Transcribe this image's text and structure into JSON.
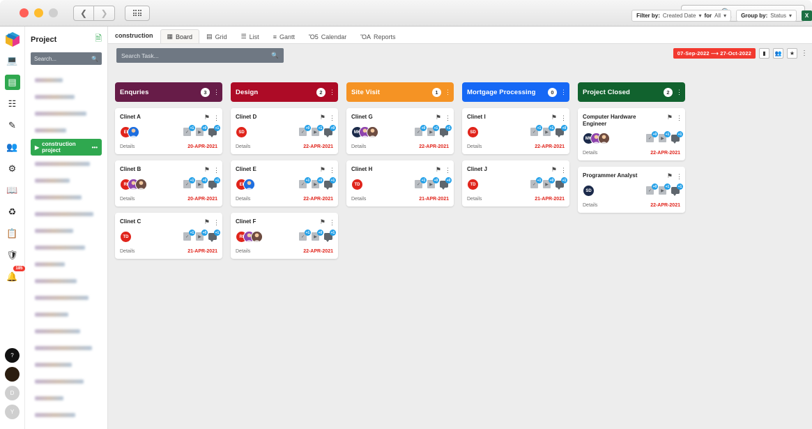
{
  "titlebar": {
    "search_label": "Search",
    "search_icon": "search-icon",
    "back_icon": "chevron-left-icon",
    "forward_icon": "chevron-right-icon",
    "grid_icon": "app-grid-icon"
  },
  "rail": {
    "logo_name": "app-logo",
    "items": [
      {
        "icon": "screen-icon",
        "active": false
      },
      {
        "icon": "dashboard-grid-icon",
        "active": true
      },
      {
        "icon": "modules-icon",
        "active": false
      },
      {
        "icon": "edit-square-icon",
        "active": false
      },
      {
        "icon": "team-icon",
        "active": false
      },
      {
        "icon": "settings-gear-icon",
        "active": false
      },
      {
        "icon": "book-icon",
        "active": false
      },
      {
        "icon": "recycle-add-icon",
        "active": false
      },
      {
        "icon": "clipboard-icon",
        "active": false
      },
      {
        "icon": "shield-icon",
        "active": false
      },
      {
        "icon": "bell-icon",
        "active": false,
        "badge": "185"
      }
    ],
    "bottom": [
      {
        "icon": "help-icon",
        "label": "?",
        "color": "#111111"
      },
      {
        "icon": "user-avatar-icon",
        "label": "",
        "color": "#2b1d10"
      },
      {
        "icon": "user-avatar-d",
        "label": "D",
        "color": "#cfcfcf"
      },
      {
        "icon": "user-avatar-y",
        "label": "Y",
        "color": "#cfcfcf"
      }
    ]
  },
  "sidebar": {
    "title": "Project",
    "export_icon": "file-export-icon",
    "search_placeholder": "Search...",
    "search_icon": "search-icon",
    "items": [
      {
        "label": "",
        "active": false
      },
      {
        "label": "",
        "active": false
      },
      {
        "label": "",
        "active": false
      },
      {
        "label": "",
        "active": false
      },
      {
        "label": "construction project",
        "active": true,
        "menu": "•••"
      },
      {
        "label": "",
        "active": false
      },
      {
        "label": "",
        "active": false
      },
      {
        "label": "",
        "active": false
      },
      {
        "label": "",
        "active": false
      },
      {
        "label": "",
        "active": false
      },
      {
        "label": "",
        "active": false
      },
      {
        "label": "",
        "active": false
      },
      {
        "label": "",
        "active": false
      },
      {
        "label": "",
        "active": false
      },
      {
        "label": "",
        "active": false
      },
      {
        "label": "",
        "active": false
      },
      {
        "label": "",
        "active": false
      },
      {
        "label": "",
        "active": false
      },
      {
        "label": "",
        "active": false
      },
      {
        "label": "",
        "active": false
      },
      {
        "label": "",
        "active": false
      }
    ]
  },
  "tabs": {
    "project_label": "construction",
    "items": [
      {
        "label": "Board",
        "icon": "board-icon",
        "active": true
      },
      {
        "label": "Grid",
        "icon": "grid-icon",
        "active": false
      },
      {
        "label": "List",
        "icon": "list-icon",
        "active": false
      },
      {
        "label": "Gantt",
        "icon": "gantt-icon",
        "active": false
      },
      {
        "label": "Calendar",
        "icon": "calendar-icon",
        "active": false
      },
      {
        "label": "Reports",
        "icon": "reports-icon",
        "active": false
      }
    ]
  },
  "toolbar": {
    "task_search_placeholder": "Search Task...",
    "task_search_icon": "search-icon",
    "filter_by_label": "Filter by:",
    "filter_by_value": "Created Date",
    "for_label": "for",
    "for_value": "All",
    "group_by_label": "Group by:",
    "group_by_value": "Status",
    "excel_icon": "excel-export-icon",
    "date_range": "07-Sep-2022 ⟶ 27-Oct-2022",
    "icon_buttons": [
      {
        "name": "flag-filter-icon"
      },
      {
        "name": "members-filter-icon"
      },
      {
        "name": "tag-filter-icon"
      }
    ],
    "more_menu_icon": "vertical-dots-icon"
  },
  "board": {
    "columns": [
      {
        "name": "Enquries",
        "count": "3",
        "color": "#671c48",
        "cards": [
          {
            "title": "Clinet A",
            "details_label": "Details",
            "date": "20-APR-2021",
            "avatars": [
              {
                "initials": "EI",
                "color": "#e0241b"
              },
              {
                "initials": "",
                "color": "#1e6fe0",
                "photo": true
              }
            ],
            "badges": [
              {
                "icon": "attachment-doc-icon",
                "count": "+1"
              },
              {
                "icon": "media-doc-icon",
                "count": "+0"
              },
              {
                "icon": "comment-icon",
                "count": "+1"
              }
            ]
          },
          {
            "title": "Clinet B",
            "details_label": "Details",
            "date": "20-APR-2021",
            "avatars": [
              {
                "initials": "RI",
                "color": "#e0241b"
              },
              {
                "initials": "",
                "color": "#8e44ad",
                "photo": true
              },
              {
                "initials": "",
                "color": "#6d4c41",
                "photo": true
              }
            ],
            "badges": [
              {
                "icon": "attachment-doc-icon",
                "count": "+1"
              },
              {
                "icon": "media-doc-icon",
                "count": "+0"
              },
              {
                "icon": "comment-icon",
                "count": "+1"
              }
            ]
          },
          {
            "title": "Clinet C",
            "details_label": "Details",
            "date": "21-APR-2021",
            "avatars": [
              {
                "initials": "TD",
                "color": "#e0241b"
              }
            ],
            "badges": [
              {
                "icon": "attachment-doc-icon",
                "count": "+1"
              },
              {
                "icon": "media-doc-icon",
                "count": "+0"
              },
              {
                "icon": "comment-icon",
                "count": "+1"
              }
            ]
          }
        ]
      },
      {
        "name": "Design",
        "count": "2",
        "color": "#ad0b26",
        "cards": [
          {
            "title": "Clinet D",
            "details_label": "Details",
            "date": "22-APR-2021",
            "avatars": [
              {
                "initials": "SD",
                "color": "#e0241b"
              }
            ],
            "badges": [
              {
                "icon": "attachment-doc-icon",
                "count": "+0"
              },
              {
                "icon": "media-doc-icon",
                "count": "+1"
              },
              {
                "icon": "comment-icon",
                "count": "+0"
              }
            ]
          },
          {
            "title": "Clinet E",
            "details_label": "Details",
            "date": "22-APR-2021",
            "avatars": [
              {
                "initials": "EI",
                "color": "#e0241b"
              },
              {
                "initials": "",
                "color": "#1e6fe0",
                "photo": true
              }
            ],
            "badges": [
              {
                "icon": "attachment-doc-icon",
                "count": "+1"
              },
              {
                "icon": "media-doc-icon",
                "count": "+0"
              },
              {
                "icon": "comment-icon",
                "count": "+1"
              }
            ]
          },
          {
            "title": "Clinet F",
            "details_label": "Details",
            "date": "22-APR-2021",
            "avatars": [
              {
                "initials": "RI",
                "color": "#e0241b"
              },
              {
                "initials": "",
                "color": "#8e44ad",
                "photo": true
              },
              {
                "initials": "",
                "color": "#6d4c41",
                "photo": true
              }
            ],
            "badges": [
              {
                "icon": "attachment-doc-icon",
                "count": "+1"
              },
              {
                "icon": "media-doc-icon",
                "count": "+0"
              },
              {
                "icon": "comment-icon",
                "count": "+1"
              }
            ]
          }
        ]
      },
      {
        "name": "Site Visit",
        "count": "1",
        "color": "#f59324",
        "cards": [
          {
            "title": "Clinet G",
            "details_label": "Details",
            "date": "22-APR-2021",
            "avatars": [
              {
                "initials": "MK",
                "color": "#1b2a4a"
              },
              {
                "initials": "",
                "color": "#8e44ad",
                "photo": true
              },
              {
                "initials": "",
                "color": "#6d4c41",
                "photo": true
              }
            ],
            "badges": [
              {
                "icon": "attachment-doc-icon",
                "count": "+0"
              },
              {
                "icon": "media-doc-icon",
                "count": "+1"
              },
              {
                "icon": "comment-icon",
                "count": "+1"
              }
            ]
          },
          {
            "title": "Clinet H",
            "details_label": "Details",
            "date": "21-APR-2021",
            "avatars": [
              {
                "initials": "TD",
                "color": "#e0241b"
              }
            ],
            "badges": [
              {
                "icon": "attachment-doc-icon",
                "count": "+1"
              },
              {
                "icon": "media-doc-icon",
                "count": "+0"
              },
              {
                "icon": "comment-icon",
                "count": "+0"
              }
            ]
          }
        ]
      },
      {
        "name": "Mortgage Processing",
        "count": "0",
        "color": "#1668f5",
        "cards": [
          {
            "title": "Clinet I",
            "details_label": "Details",
            "date": "22-APR-2021",
            "avatars": [
              {
                "initials": "SD",
                "color": "#e0241b"
              }
            ],
            "badges": [
              {
                "icon": "attachment-doc-icon",
                "count": "+1"
              },
              {
                "icon": "media-doc-icon",
                "count": "+1"
              },
              {
                "icon": "comment-icon",
                "count": "+0"
              }
            ]
          },
          {
            "title": "Clinet J",
            "details_label": "Details",
            "date": "21-APR-2021",
            "avatars": [
              {
                "initials": "TD",
                "color": "#e0241b"
              }
            ],
            "badges": [
              {
                "icon": "attachment-doc-icon",
                "count": "+1"
              },
              {
                "icon": "media-doc-icon",
                "count": "+0"
              },
              {
                "icon": "comment-icon",
                "count": "+1"
              }
            ]
          }
        ]
      },
      {
        "name": "Project Closed",
        "count": "2",
        "color": "#11622e",
        "cards": [
          {
            "title": "Computer Hardware Engineer",
            "details_label": "Details",
            "date": "22-APR-2021",
            "avatars": [
              {
                "initials": "MK",
                "color": "#1b2a4a"
              },
              {
                "initials": "",
                "color": "#8e44ad",
                "photo": true
              },
              {
                "initials": "",
                "color": "#6d4c41",
                "photo": true
              }
            ],
            "badges": [
              {
                "icon": "attachment-doc-icon",
                "count": "+0"
              },
              {
                "icon": "media-doc-icon",
                "count": "+1"
              },
              {
                "icon": "comment-icon",
                "count": "+1"
              }
            ]
          },
          {
            "title": "Programmer Analyst",
            "details_label": "Details",
            "date": "22-APR-2021",
            "avatars": [
              {
                "initials": "SD",
                "color": "#1b2a4a"
              }
            ],
            "badges": [
              {
                "icon": "attachment-doc-icon",
                "count": "+0"
              },
              {
                "icon": "media-doc-icon",
                "count": "+1"
              },
              {
                "icon": "comment-icon",
                "count": "+1"
              }
            ]
          }
        ]
      }
    ]
  }
}
